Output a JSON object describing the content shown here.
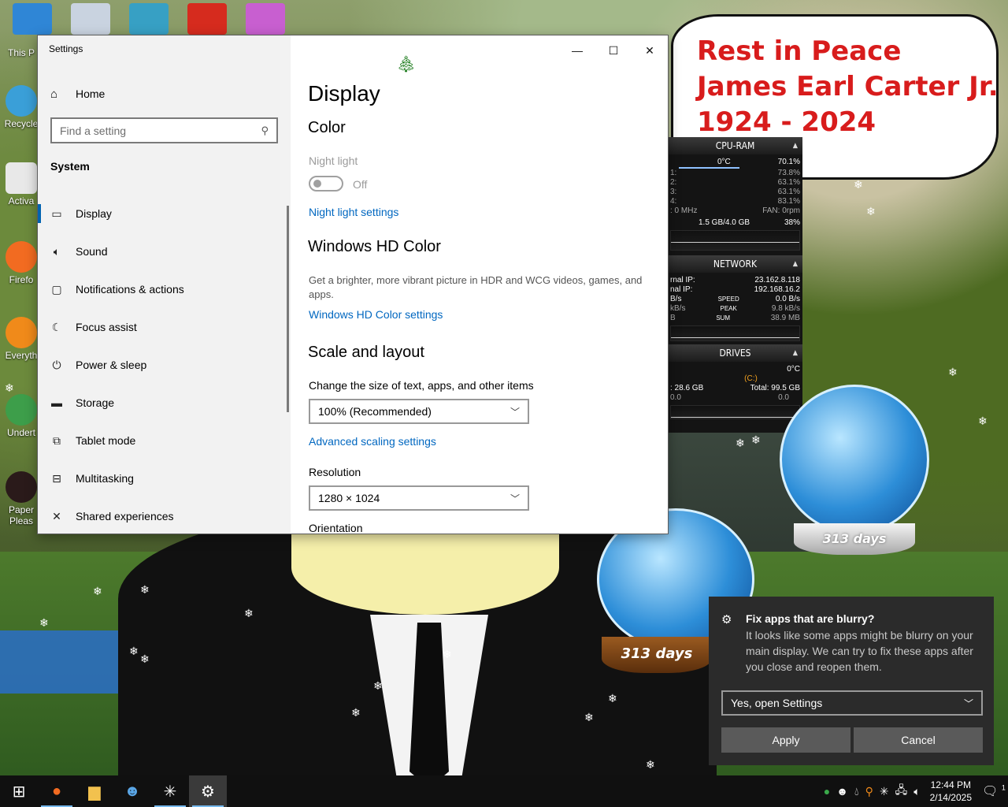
{
  "memorial": {
    "line1": "Rest in Peace",
    "line2": "James Earl Carter Jr.",
    "line3": "1924 - 2024"
  },
  "desktop_icons": [
    "This P",
    "Recycle",
    "Activa",
    "Firefo",
    "Everyth",
    "Undert",
    "Paper\nPleas"
  ],
  "monitor": {
    "cpu_header": "CPU-RAM",
    "temp": "0°C",
    "cpu_total": "70.1%",
    "cores": [
      {
        "label": "1:",
        "value": "73.8%"
      },
      {
        "label": "2:",
        "value": "63.1%"
      },
      {
        "label": "3:",
        "value": "63.1%"
      },
      {
        "label": "4:",
        "value": "83.1%"
      }
    ],
    "freq": ": 0 MHz",
    "fan": "FAN: 0rpm",
    "ram": "1.5 GB/4.0 GB",
    "ram_pct": "38%",
    "network_header": "NETWORK",
    "ext_ip_label": "rnal IP:",
    "ext_ip": "23.162.8.118",
    "int_ip_label": "nal IP:",
    "int_ip": "192.168.16.2",
    "speed_label": "SPEED",
    "speed_left": "B/s",
    "speed": "0.0 B/s",
    "peak_label": "PEAK",
    "peak_left": "kB/s",
    "peak": "9.8 kB/s",
    "sum_label": "SUM",
    "sum_left": "B",
    "sum": "38.9 MB",
    "drives_header": "DRIVES",
    "drive_temp": "0°C",
    "drive_name": "(C:)",
    "drive_free": ": 28.6 GB",
    "drive_total": "Total: 99.5 GB",
    "drive_r": "0.0",
    "drive_w": "0.0"
  },
  "globes": {
    "big_label": "313 days",
    "small_label": "313 days"
  },
  "settings": {
    "window_title": "Settings",
    "home": "Home",
    "search_placeholder": "Find a setting",
    "section": "System",
    "nav": [
      {
        "label": "Display",
        "icon": "monitor-icon"
      },
      {
        "label": "Sound",
        "icon": "speaker-icon"
      },
      {
        "label": "Notifications & actions",
        "icon": "message-icon"
      },
      {
        "label": "Focus assist",
        "icon": "moon-icon"
      },
      {
        "label": "Power & sleep",
        "icon": "power-icon"
      },
      {
        "label": "Storage",
        "icon": "drive-icon"
      },
      {
        "label": "Tablet mode",
        "icon": "tablet-icon"
      },
      {
        "label": "Multitasking",
        "icon": "multitask-icon"
      },
      {
        "label": "Shared experiences",
        "icon": "share-icon"
      }
    ],
    "page_title": "Display",
    "color_heading": "Color",
    "night_light_label": "Night light",
    "night_light_state": "Off",
    "night_light_link": "Night light settings",
    "hd_heading": "Windows HD Color",
    "hd_desc": "Get a brighter, more vibrant picture in HDR and WCG videos, games, and apps.",
    "hd_link": "Windows HD Color settings",
    "scale_heading": "Scale and layout",
    "scale_label": "Change the size of text, apps, and other items",
    "scale_value": "100% (Recommended)",
    "advanced_link": "Advanced scaling settings",
    "resolution_label": "Resolution",
    "resolution_value": "1280 × 1024",
    "orientation_label": "Orientation"
  },
  "toast": {
    "title": "Fix apps that are blurry?",
    "body": "It looks like some apps might be blurry on your main display. We can try to fix these apps after you close and reopen them.",
    "select_value": "Yes, open Settings",
    "apply": "Apply",
    "cancel": "Cancel"
  },
  "taskbar": {
    "time": "12:44 PM",
    "date": "2/14/2025",
    "notif_count": "1"
  },
  "colors": {
    "accent": "#0063b1",
    "link": "#0067c0",
    "memorial_text": "#d81c1c",
    "toast_bg": "#2b2b2b"
  }
}
